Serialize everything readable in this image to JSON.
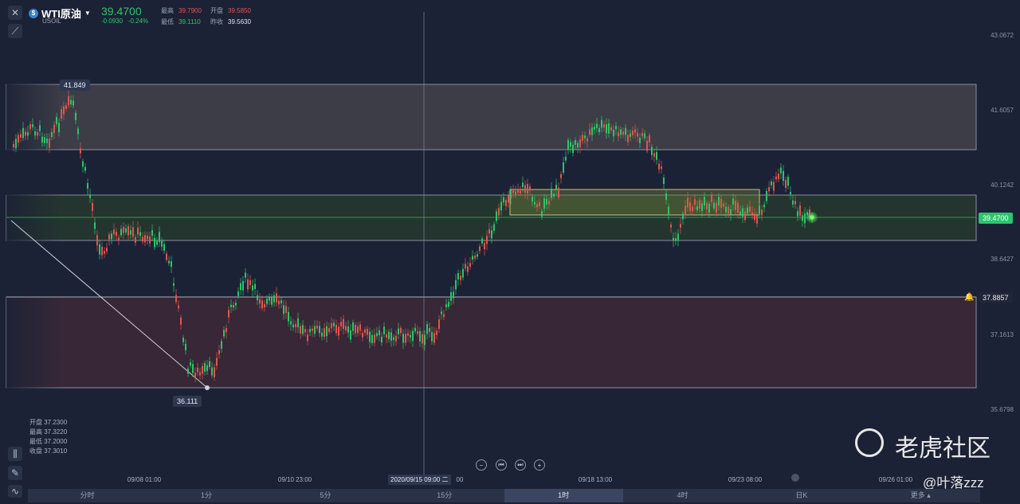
{
  "header": {
    "title": "WTI原油",
    "symbol": "USOIL",
    "price": "39.4700",
    "change": "-0.0930",
    "change_pct": "-0.24%",
    "high_label": "最高",
    "high_value": "39.7900",
    "open_label": "开盘",
    "open_value": "39.5850",
    "low_label": "最低",
    "low_value": "39.1110",
    "prev_close_label": "昨收",
    "prev_close_value": "39.5630"
  },
  "left_ohlc": {
    "open": "开盘 37.2300",
    "high": "最高 37.3220",
    "low": "最低 37.2000",
    "close": "收盘 37.3010"
  },
  "y_axis_labels": [
    "43.0672",
    "41.6057",
    "40.1242",
    "38.6427",
    "37.1613",
    "35.6798"
  ],
  "markers": {
    "high_mark": "41.849",
    "low_mark": "36.111",
    "current_price": "39.4700",
    "alert_price": "37.8857",
    "crosshair_time": "2020/09/15 09:00 二"
  },
  "x_axis_labels": [
    "09/08 01:00",
    "09/10 23:00",
    "00",
    "09/18 13:00",
    "09/23 08:00",
    "09/26 01:00"
  ],
  "timeframes": [
    {
      "label": "分时"
    },
    {
      "label": "1分"
    },
    {
      "label": "5分"
    },
    {
      "label": "15分"
    },
    {
      "label": "1时"
    },
    {
      "label": "4时"
    },
    {
      "label": "日K"
    },
    {
      "label": "更多 ▴"
    }
  ],
  "watermark": {
    "brand": "老虎社区",
    "user": "@叶落zzz"
  },
  "colors": {
    "up": "#e0554f",
    "down": "#2fc36b",
    "bg": "#1b2236",
    "accent": "#2fc36b"
  },
  "chart_data": {
    "type": "candlestick",
    "y_range": [
      35.68,
      43.07
    ],
    "x": [
      "09/08 01:00",
      "09/10 23:00",
      "09/15 09:00",
      "09/18 13:00",
      "09/23 08:00",
      "09/26 01:00"
    ],
    "y_ticks": [
      43.0672,
      41.6057,
      40.1242,
      38.6427,
      37.1613,
      35.6798
    ],
    "last_price": 39.47,
    "annotations": [
      41.849,
      36.111,
      37.8857
    ]
  }
}
